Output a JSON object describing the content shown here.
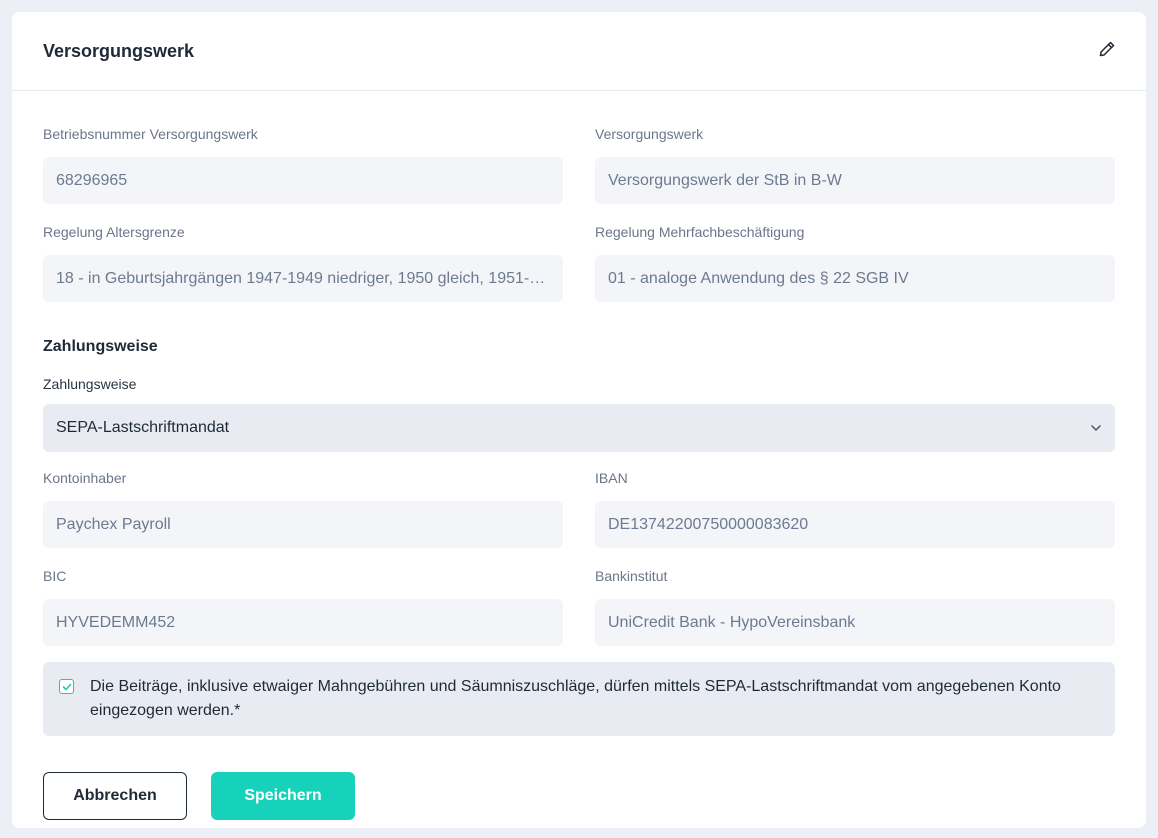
{
  "header": {
    "title": "Versorgungswerk"
  },
  "fields": {
    "betriebsnummer": {
      "label": "Betriebsnummer Versorgungswerk",
      "value": "68296965"
    },
    "versorgungswerk": {
      "label": "Versorgungswerk",
      "value": "Versorgungswerk der StB in B-W"
    },
    "altersgrenze": {
      "label": "Regelung Altersgrenze",
      "value": "18 - in Geburtsjahrgängen 1947-1949 niedriger, 1950 gleich, 1951-19..."
    },
    "mehrfach": {
      "label": "Regelung Mehrfachbeschäftigung",
      "value": "01 - analoge Anwendung des § 22 SGB IV"
    }
  },
  "payment": {
    "section_title": "Zahlungsweise",
    "select_label": "Zahlungsweise",
    "select_value": "SEPA-Lastschriftmandat",
    "kontoinhaber": {
      "label": "Kontoinhaber",
      "value": "Paychex Payroll"
    },
    "iban": {
      "label": "IBAN",
      "value": "DE13742200750000083620"
    },
    "bic": {
      "label": "BIC",
      "value": "HYVEDEMM452"
    },
    "bankinstitut": {
      "label": "Bankinstitut",
      "value": "UniCredit Bank - HypoVereinsbank"
    }
  },
  "consent": {
    "checked": true,
    "text": "Die Beiträge, inklusive etwaiger Mahngebühren und Säumniszuschläge, dürfen mittels SEPA-Lastschriftmandat vom angegebenen Konto eingezogen werden.*"
  },
  "actions": {
    "cancel_label": "Abbrechen",
    "save_label": "Speichern"
  },
  "colors": {
    "accent": "#17d2bb",
    "background": "#eceff5",
    "input_bg": "#f3f5f9"
  },
  "icons": {
    "edit": "pencil-icon",
    "select": "chevron-down-icon",
    "check": "check-icon"
  }
}
